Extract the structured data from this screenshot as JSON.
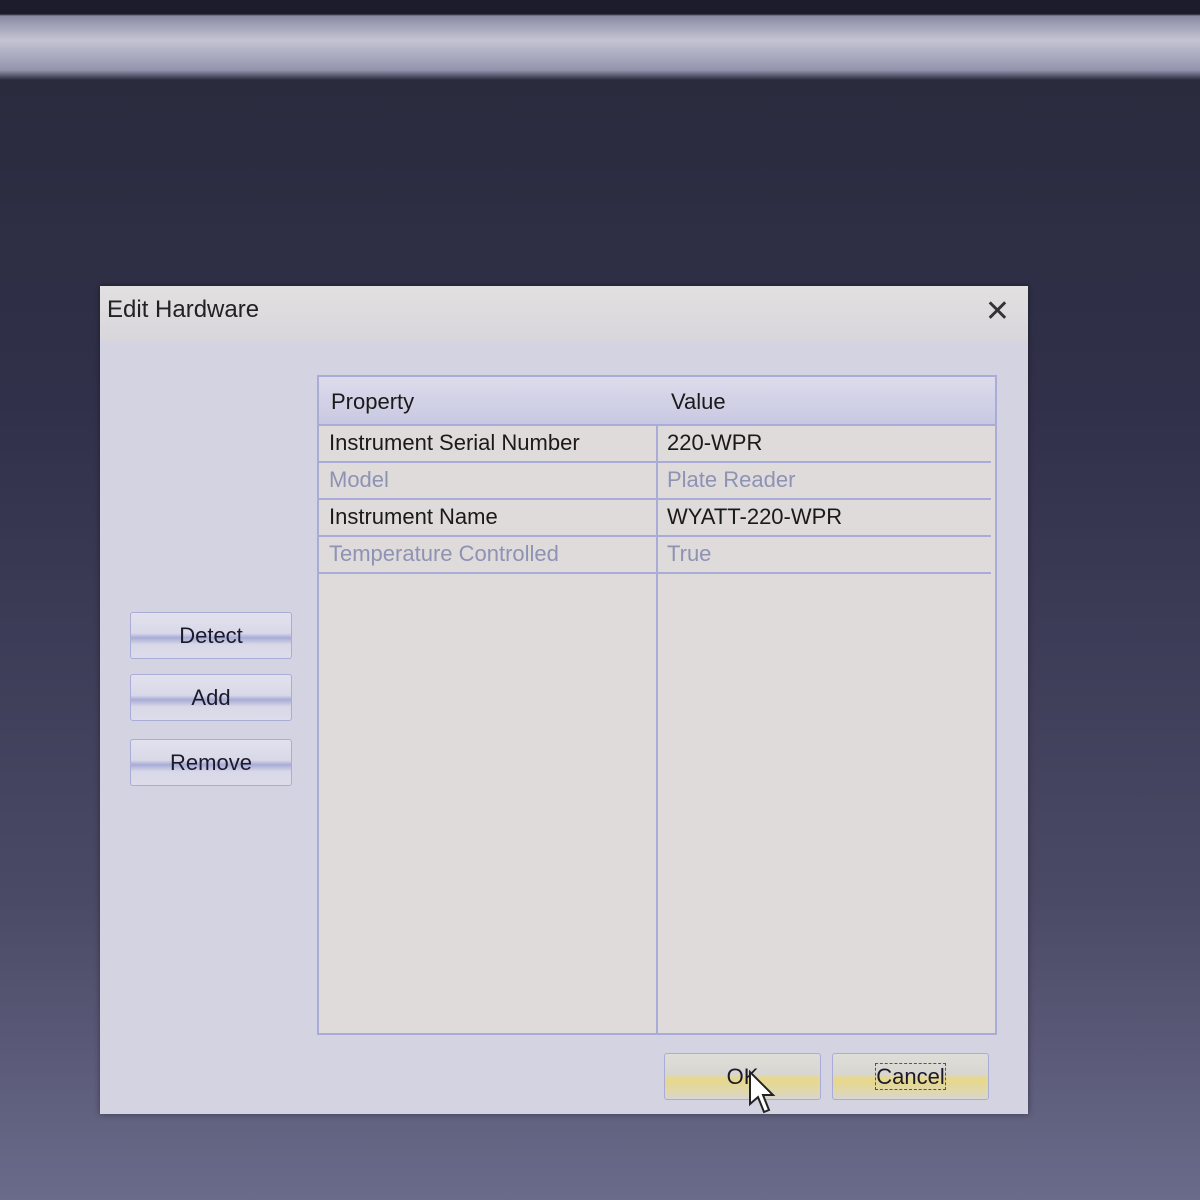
{
  "dialog": {
    "title": "Edit Hardware",
    "close_icon": "close-icon"
  },
  "table": {
    "columns": [
      "Property",
      "Value"
    ],
    "rows": [
      {
        "property": "Instrument Serial Number",
        "value": "220-WPR",
        "enabled": true
      },
      {
        "property": "Model",
        "value": "Plate Reader",
        "enabled": false
      },
      {
        "property": "Instrument Name",
        "value": "WYATT-220-WPR",
        "enabled": true
      },
      {
        "property": "Temperature Controlled",
        "value": "True",
        "enabled": false
      }
    ]
  },
  "side_buttons": {
    "detect": "Detect",
    "add": "Add",
    "remove": "Remove"
  },
  "footer": {
    "ok": "OK",
    "cancel": "Cancel"
  },
  "colors": {
    "accent": "#a8acd6",
    "button_highlight": "#e8d88a"
  }
}
